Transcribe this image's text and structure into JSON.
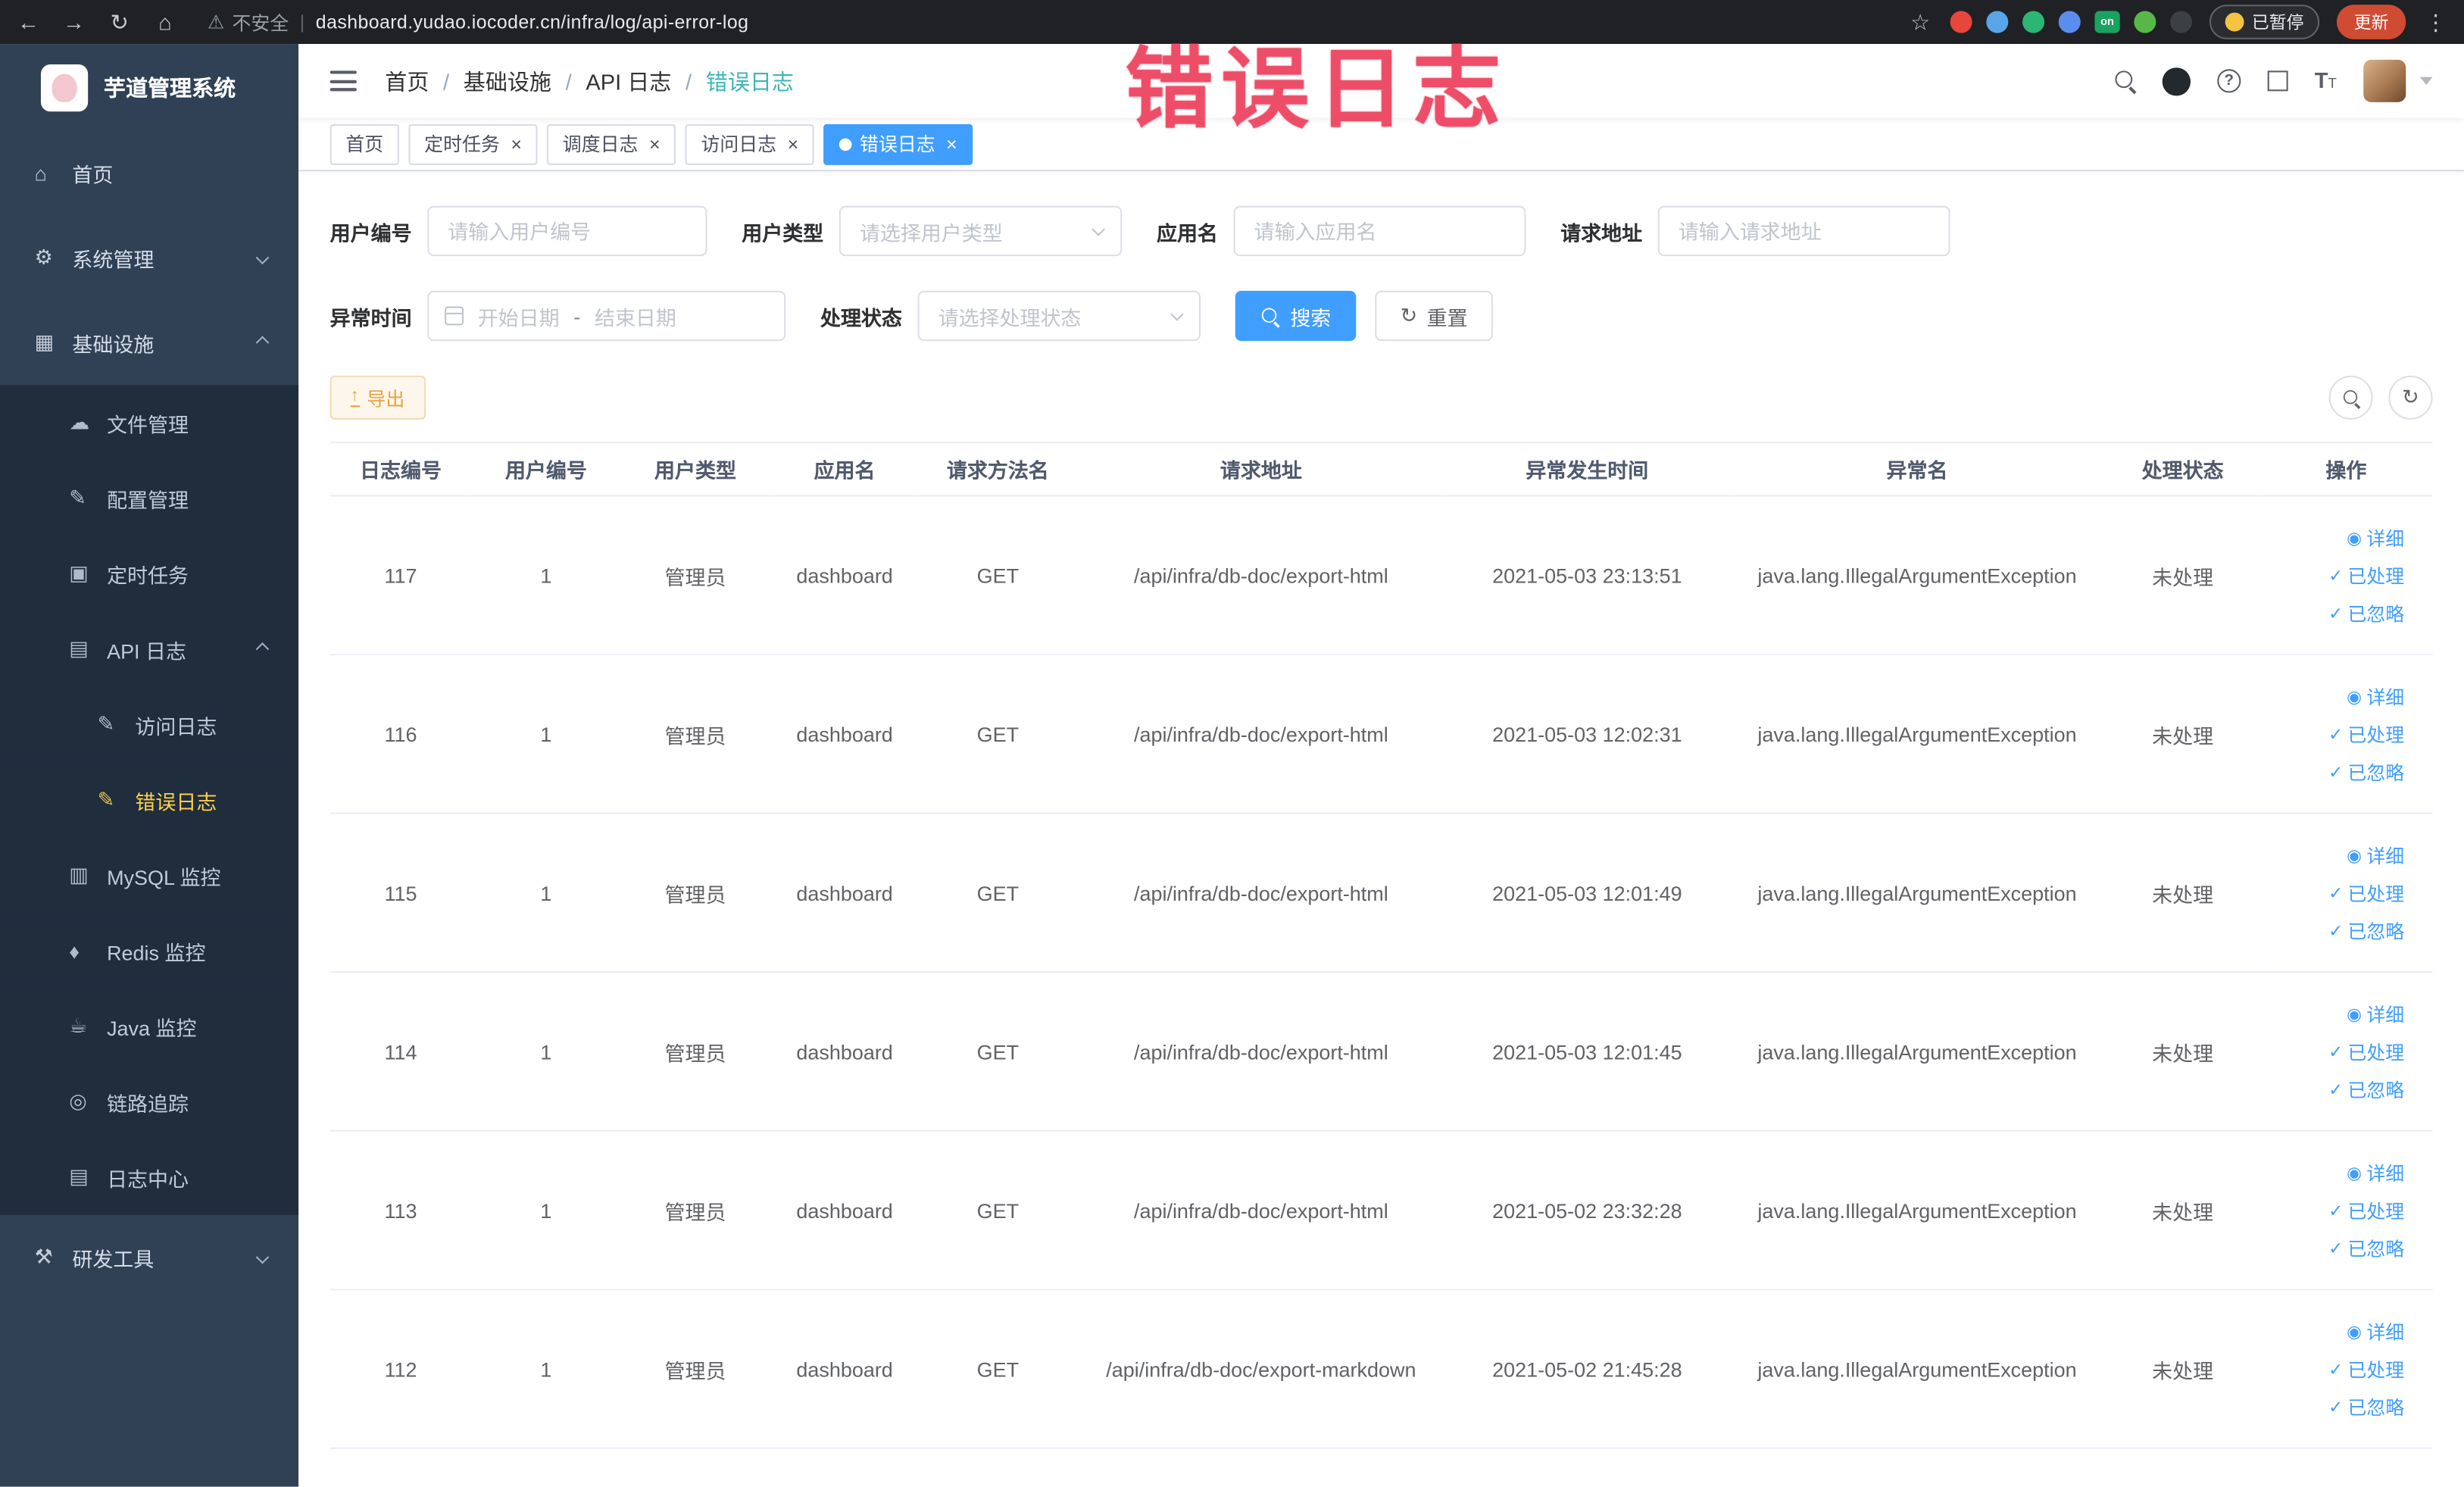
{
  "browser": {
    "security_label": "不安全",
    "url": "dashboard.yudao.iocoder.cn/infra/log/api-error-log",
    "paused_badge": "已暂停",
    "update_button": "更新",
    "extensions": [
      {
        "name": "extension-icon-red-circle",
        "color": "#e8453c"
      },
      {
        "name": "extension-icon-blue-drop",
        "color": "#58a6e8"
      },
      {
        "name": "extension-icon-green-circle",
        "color": "#2bb673"
      },
      {
        "name": "extension-icon-blue-grid",
        "color": "#5b8def"
      },
      {
        "name": "extension-icon-on-badge",
        "color": "#1aa260",
        "text": "on"
      },
      {
        "name": "extension-icon-green-leaf",
        "color": "#57b847"
      },
      {
        "name": "extension-icon-paw",
        "color": "#3c4043"
      }
    ]
  },
  "sidebar": {
    "logo_title": "芋道管理系统",
    "items": [
      {
        "id": "home",
        "label": "首页",
        "icon": "home",
        "level": 1
      },
      {
        "id": "system-management",
        "label": "系统管理",
        "icon": "gear",
        "level": 1,
        "arrow": "down"
      },
      {
        "id": "infrastructure",
        "label": "基础设施",
        "icon": "grid",
        "level": 1,
        "arrow": "up"
      },
      {
        "id": "file-management",
        "label": "文件管理",
        "icon": "cloud",
        "level": 2,
        "sub": true
      },
      {
        "id": "config-management",
        "label": "配置管理",
        "icon": "edit",
        "level": 2,
        "sub": true
      },
      {
        "id": "scheduled-jobs",
        "label": "定时任务",
        "icon": "timer",
        "level": 2,
        "sub": true
      },
      {
        "id": "api-logs",
        "label": "API 日志",
        "icon": "log",
        "level": 2,
        "sub": true,
        "arrow": "up"
      },
      {
        "id": "access-log",
        "label": "访问日志",
        "icon": "doc",
        "level": 3,
        "sub": true
      },
      {
        "id": "error-log",
        "label": "错误日志",
        "icon": "doc",
        "level": 3,
        "sub": true,
        "active": true
      },
      {
        "id": "mysql-monitor",
        "label": "MySQL 监控",
        "icon": "db",
        "level": 2,
        "sub": true
      },
      {
        "id": "redis-monitor",
        "label": "Redis 监控",
        "icon": "redis",
        "level": 2,
        "sub": true
      },
      {
        "id": "java-monitor",
        "label": "Java 监控",
        "icon": "java",
        "level": 2,
        "sub": true
      },
      {
        "id": "link-tracing",
        "label": "链路追踪",
        "icon": "trace",
        "level": 2,
        "sub": true
      },
      {
        "id": "log-center",
        "label": "日志中心",
        "icon": "log",
        "level": 2,
        "sub": true
      },
      {
        "id": "dev-tools",
        "label": "研发工具",
        "icon": "tools",
        "level": 1,
        "arrow": "down"
      }
    ]
  },
  "header": {
    "breadcrumb": [
      "首页",
      "基础设施",
      "API 日志",
      "错误日志"
    ],
    "watermark": "错误日志"
  },
  "tabs": [
    {
      "label": "首页",
      "closable": false,
      "active": false
    },
    {
      "label": "定时任务",
      "closable": true,
      "active": false
    },
    {
      "label": "调度日志",
      "closable": true,
      "active": false
    },
    {
      "label": "访问日志",
      "closable": true,
      "active": false
    },
    {
      "label": "错误日志",
      "closable": true,
      "active": true
    }
  ],
  "filters": {
    "user_id": {
      "label": "用户编号",
      "placeholder": "请输入用户编号"
    },
    "user_type": {
      "label": "用户类型",
      "placeholder": "请选择用户类型"
    },
    "app_name": {
      "label": "应用名",
      "placeholder": "请输入应用名"
    },
    "request_url": {
      "label": "请求地址",
      "placeholder": "请输入请求地址"
    },
    "exception_time": {
      "label": "异常时间",
      "start_placeholder": "开始日期",
      "separator": "-",
      "end_placeholder": "结束日期"
    },
    "process_status": {
      "label": "处理状态",
      "placeholder": "请选择处理状态"
    },
    "search_button": "搜索",
    "reset_button": "重置"
  },
  "toolbar": {
    "export_button": "导出"
  },
  "table": {
    "columns": [
      "日志编号",
      "用户编号",
      "用户类型",
      "应用名",
      "请求方法名",
      "请求地址",
      "异常发生时间",
      "异常名",
      "处理状态",
      "操作"
    ],
    "actions": [
      {
        "id": "detail",
        "icon": "eye",
        "label": "详细"
      },
      {
        "id": "processed",
        "icon": "check",
        "label": "已处理"
      },
      {
        "id": "ignored",
        "icon": "check",
        "label": "已忽略"
      }
    ],
    "rows": [
      [
        "117",
        "1",
        "管理员",
        "dashboard",
        "GET",
        "/api/infra/db-doc/export-html",
        "2021-05-03 23:13:51",
        "java.lang.IllegalArgumentException",
        "未处理"
      ],
      [
        "116",
        "1",
        "管理员",
        "dashboard",
        "GET",
        "/api/infra/db-doc/export-html",
        "2021-05-03 12:02:31",
        "java.lang.IllegalArgumentException",
        "未处理"
      ],
      [
        "115",
        "1",
        "管理员",
        "dashboard",
        "GET",
        "/api/infra/db-doc/export-html",
        "2021-05-03 12:01:49",
        "java.lang.IllegalArgumentException",
        "未处理"
      ],
      [
        "114",
        "1",
        "管理员",
        "dashboard",
        "GET",
        "/api/infra/db-doc/export-html",
        "2021-05-03 12:01:45",
        "java.lang.IllegalArgumentException",
        "未处理"
      ],
      [
        "113",
        "1",
        "管理员",
        "dashboard",
        "GET",
        "/api/infra/db-doc/export-html",
        "2021-05-02 23:32:28",
        "java.lang.IllegalArgumentException",
        "未处理"
      ],
      [
        "112",
        "1",
        "管理员",
        "dashboard",
        "GET",
        "/api/infra/db-doc/export-markdown",
        "2021-05-02 21:45:28",
        "java.lang.IllegalArgumentException",
        "未处理"
      ]
    ]
  }
}
